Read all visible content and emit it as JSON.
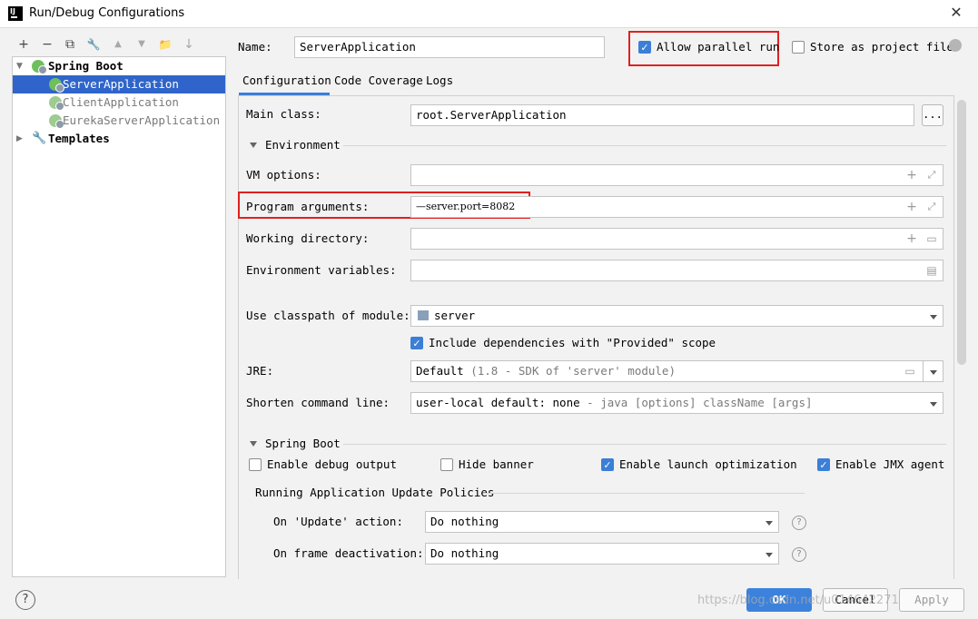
{
  "window": {
    "title": "Run/Debug Configurations",
    "close_glyph": "✕"
  },
  "toolbar": {
    "add": "+",
    "remove": "−",
    "copy": "⧉",
    "edit": "🔧",
    "up": "▲",
    "down": "▼",
    "folder": "📁",
    "sort": "↓"
  },
  "tree": {
    "group": "Spring Boot",
    "items": [
      "ServerApplication",
      "ClientApplication",
      "EurekaServerApplication"
    ],
    "templates": "Templates"
  },
  "header": {
    "name_label": "Name:",
    "name_value": "ServerApplication",
    "allow_parallel": "Allow parallel run",
    "store_project": "Store as project file"
  },
  "tabs": [
    "Configuration",
    "Code Coverage",
    "Logs"
  ],
  "form": {
    "main_class_label": "Main class:",
    "main_class_value": "root.ServerApplication",
    "browse": "...",
    "environment_section": "Environment",
    "vm_options_label": "VM options:",
    "program_args_label": "Program arguments:",
    "program_args_value": "—server.port=8082",
    "working_dir_label": "Working directory:",
    "env_vars_label": "Environment variables:",
    "classpath_label": "Use classpath of module:",
    "classpath_value": "server",
    "include_deps": "Include dependencies with \"Provided\" scope",
    "jre_label": "JRE:",
    "jre_value": "Default",
    "jre_hint": "(1.8 - SDK of 'server' module)",
    "shorten_label": "Shorten command line:",
    "shorten_value": "user-local default: none",
    "shorten_hint": "- java [options] className [args]"
  },
  "spring": {
    "section": "Spring Boot",
    "debug_output": "Enable debug output",
    "hide_banner": "Hide banner",
    "launch_opt": "Enable launch optimization",
    "jmx": "Enable JMX agent",
    "policies": "Running Application Update Policies",
    "update_label": "On 'Update' action:",
    "update_value": "Do nothing",
    "frame_label": "On frame deactivation:",
    "frame_value": "Do nothing"
  },
  "footer": {
    "help": "?",
    "ok": "OK",
    "cancel": "Cancel",
    "apply": "Apply",
    "watermark": "https://blog.csdn.net/u014642271"
  },
  "colors": {
    "selection": "#2f65ca",
    "accent": "#3c7fd6",
    "highlight_box": "#e02020"
  }
}
